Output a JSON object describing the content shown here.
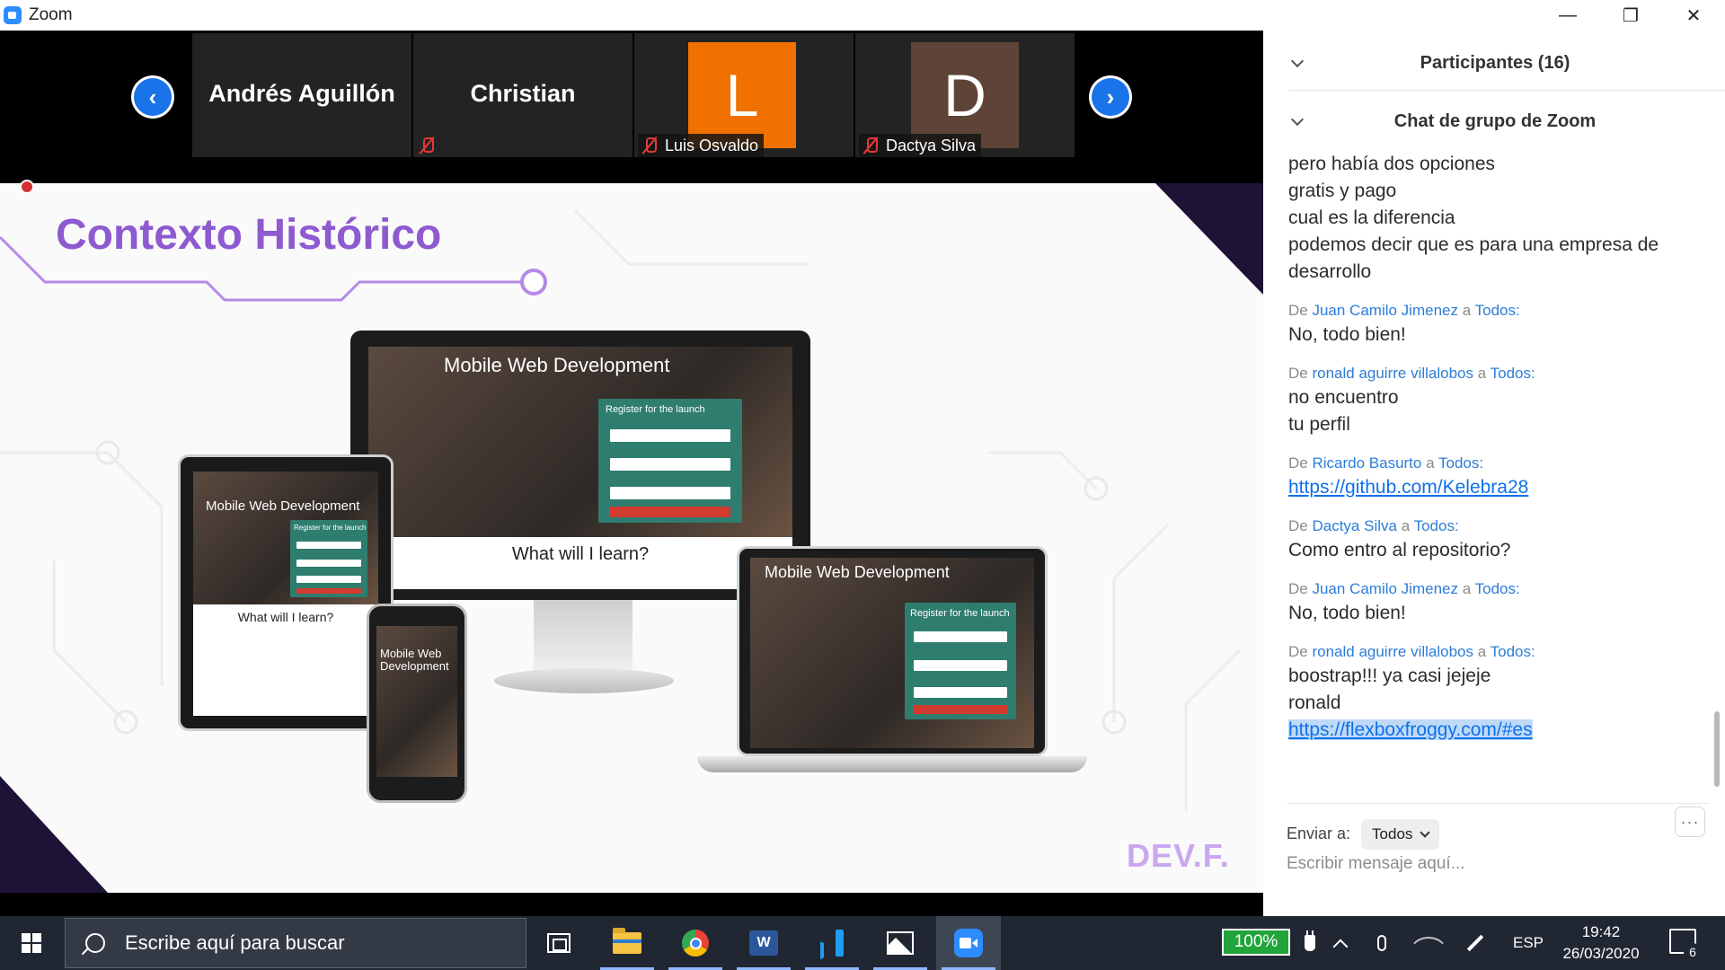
{
  "window": {
    "title": "Zoom",
    "minimize": "—",
    "maximize": "❐",
    "close": "✕"
  },
  "video_strip": {
    "prev_arrow": "‹",
    "next_arrow": "›",
    "tiles": [
      {
        "name": "Andrés Aguillón",
        "label": ""
      },
      {
        "name": "Christian",
        "label": ""
      },
      {
        "avatar_letter": "L",
        "avatar_color": "#f07100",
        "label": "Luis Osvaldo"
      },
      {
        "avatar_letter": "D",
        "avatar_color": "#5e4337",
        "label": "Dactya Silva"
      }
    ]
  },
  "share": {
    "slide_title": "Contexto Histórico",
    "brand": "DEV.F.",
    "accent_color": "#8e5ad0",
    "mockup": {
      "hero_title": "Mobile Web Development",
      "form_title": "Register for the launch",
      "learn_heading": "What will I learn?"
    }
  },
  "panel": {
    "participants_title": "Participantes (16)",
    "chat_title": "Chat de grupo de Zoom",
    "messages": {
      "m0": {
        "lines": [
          "pero había dos opciones",
          "gratis y pago",
          "cual es la diferencia",
          "podemos decir que es para una empresa de",
          "desarrollo"
        ]
      },
      "m1": {
        "from_prefix": "De",
        "from": "Juan Camilo Jimenez",
        "to_prefix": "a",
        "to": "Todos:",
        "lines": [
          "No, todo bien!"
        ]
      },
      "m2": {
        "from_prefix": "De",
        "from": "ronald aguirre villalobos",
        "to_prefix": "a",
        "to": "Todos:",
        "lines": [
          "no encuentro",
          "tu perfil"
        ]
      },
      "m3": {
        "from_prefix": "De",
        "from": "Ricardo Basurto",
        "to_prefix": "a",
        "to": "Todos:",
        "link": "https://github.com/Kelebra28"
      },
      "m4": {
        "from_prefix": "De",
        "from": "Dactya Silva",
        "to_prefix": "a",
        "to": "Todos:",
        "lines": [
          "Como entro al repositorio?"
        ]
      },
      "m5": {
        "from_prefix": "De",
        "from": "Juan Camilo Jimenez",
        "to_prefix": "a",
        "to": "Todos:",
        "lines": [
          "No, todo bien!"
        ]
      },
      "m6": {
        "from_prefix": "De",
        "from": "ronald aguirre villalobos",
        "to_prefix": "a",
        "to": "Todos:",
        "lines": [
          "boostrap!!! ya casi jejeje",
          "ronald"
        ],
        "link": "https://flexboxfroggy.com/#es"
      }
    },
    "send_to_label": "Enviar a:",
    "send_to_value": "Todos",
    "more_label": "···",
    "input_placeholder": "Escribir mensaje aquí..."
  },
  "taskbar": {
    "search_placeholder": "Escribe aquí para buscar",
    "battery": "100%",
    "language": "ESP",
    "time": "19:42",
    "date": "26/03/2020",
    "notifications_count": "6"
  }
}
